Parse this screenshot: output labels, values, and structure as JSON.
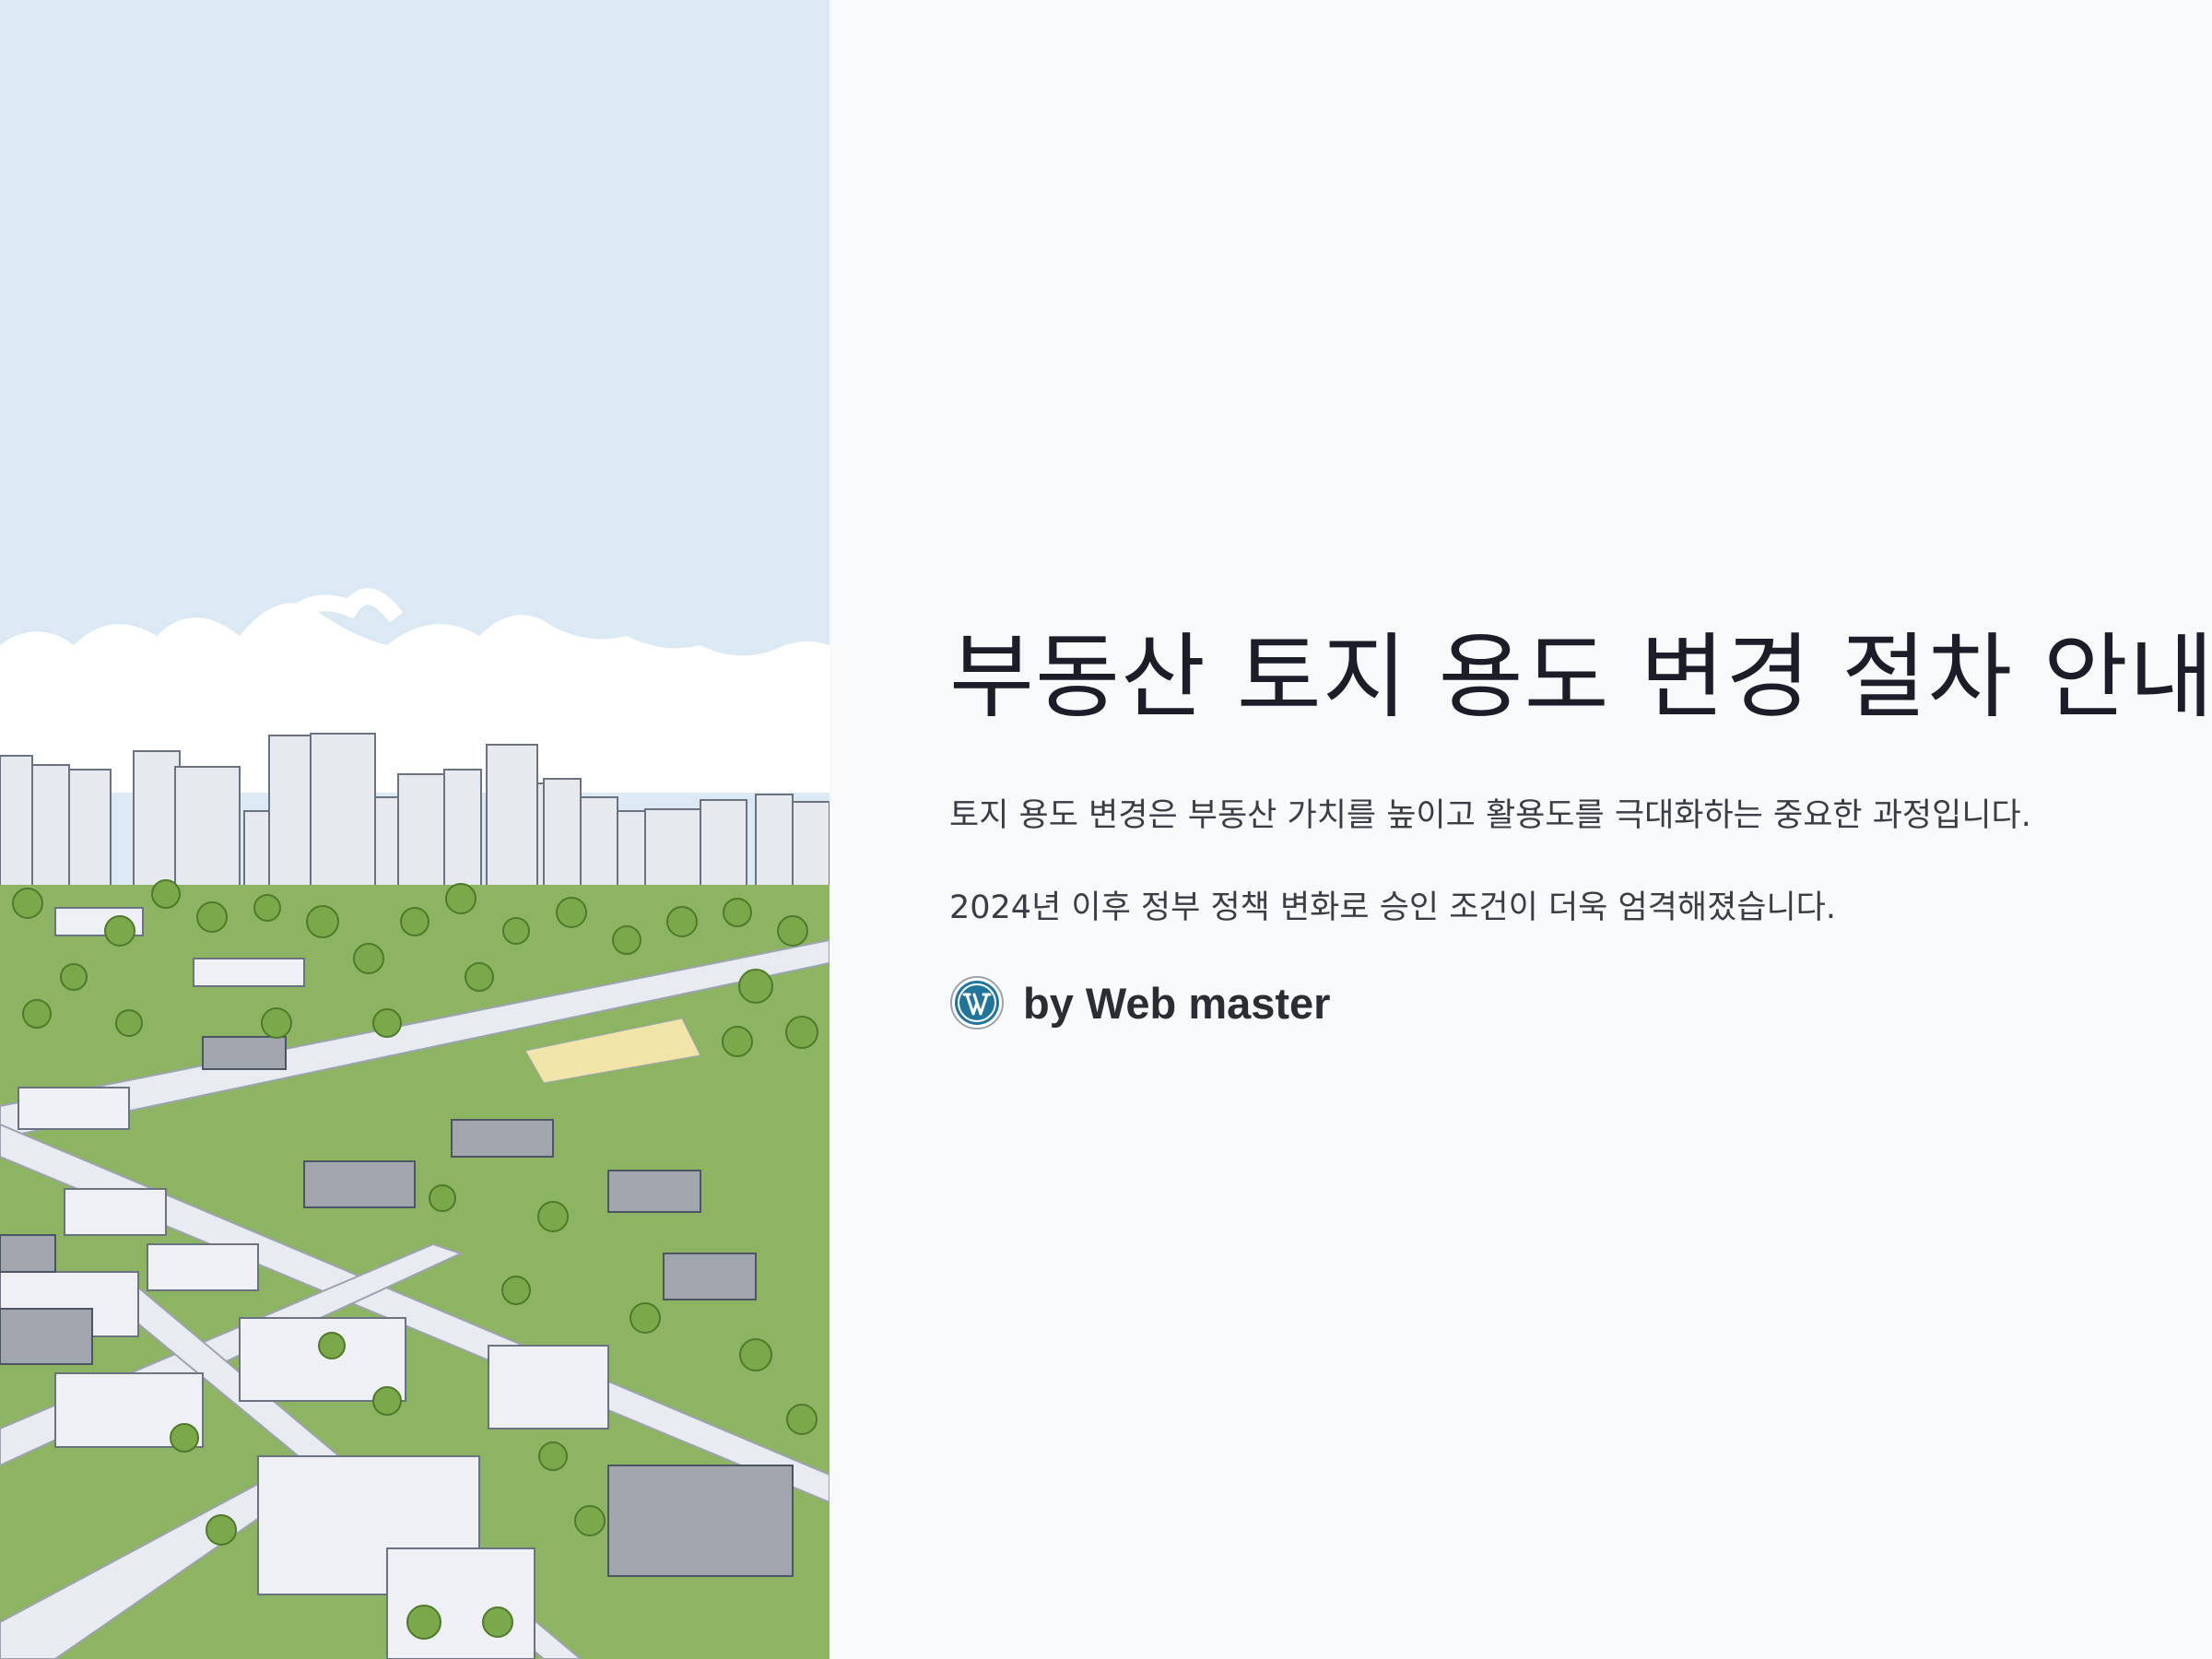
{
  "article": {
    "title": "부동산 토지 용도 변경 절차 안내",
    "paragraphs": [
      "토지 용도 변경은 부동산 가치를 높이고 활용도를 극대화하는 중요한 과정입니다.",
      "2024년 이후 정부 정책 변화로 승인 조건이 더욱 엄격해졌습니다."
    ],
    "author": "by Web master",
    "author_icon": "wordpress-logo-icon"
  },
  "illustration": {
    "subject": "urban-landscape-illustration"
  },
  "colors": {
    "background": "#f8f9fb",
    "sky": "#dae9f4",
    "grass": "#8db463",
    "tree": "#7aa84a",
    "building": "#e6e9ee",
    "title_text": "#1b1d29",
    "body_text": "#3a3d45",
    "wp_blue": "#21759b"
  }
}
